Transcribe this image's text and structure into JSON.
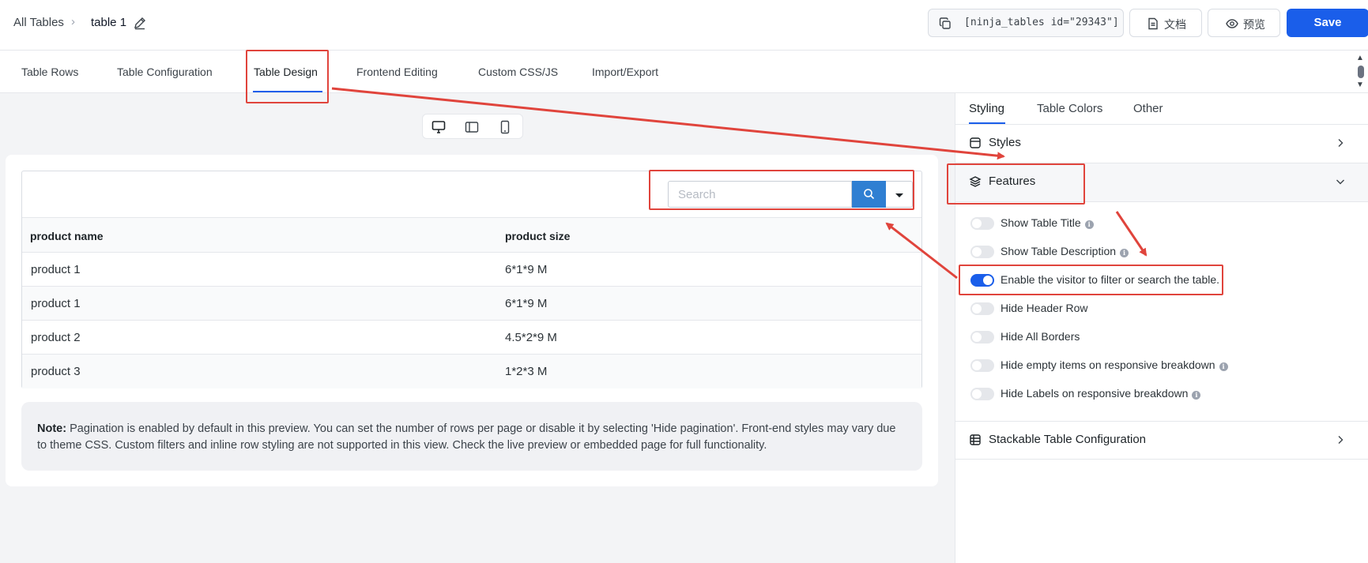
{
  "header": {
    "breadcrumb_all": "All Tables",
    "breadcrumb_sep": "›",
    "table_title": "table 1",
    "shortcode": "[ninja_tables id=\"29343\"]",
    "doc_label": "文档",
    "preview_label": "预览",
    "save_label": "Save"
  },
  "tabs": [
    {
      "label": "Table Rows"
    },
    {
      "label": "Table Configuration"
    },
    {
      "label": "Table Design",
      "active": true
    },
    {
      "label": "Frontend Editing"
    },
    {
      "label": "Custom CSS/JS"
    },
    {
      "label": "Import/Export"
    }
  ],
  "preview": {
    "devices": [
      "desktop-icon",
      "tablet-icon",
      "mobile-icon"
    ],
    "search_placeholder": "Search",
    "columns": [
      "product name",
      "product size"
    ],
    "rows": [
      [
        "product 1",
        "6*1*9 M"
      ],
      [
        "product 1",
        "6*1*9 M"
      ],
      [
        "product 2",
        "4.5*2*9 M"
      ],
      [
        "product 3",
        "1*2*3 M"
      ]
    ],
    "note_label": "Note:",
    "note_text": "Pagination is enabled by default in this preview. You can set the number of rows per page or disable it by selecting 'Hide pagination'. Front-end styles may vary due to theme CSS. Custom filters and inline row styling are not supported in this view. Check the live preview or embedded page for full functionality."
  },
  "panel": {
    "tabs": [
      {
        "label": "Styling",
        "active": true
      },
      {
        "label": "Table Colors"
      },
      {
        "label": "Other"
      }
    ],
    "sections": {
      "styles": "Styles",
      "features": "Features",
      "stackable": "Stackable Table Configuration"
    },
    "features": [
      {
        "label": "Show Table Title",
        "enabled": false,
        "info": true
      },
      {
        "label": "Show Table Description",
        "enabled": false,
        "info": true
      },
      {
        "label": "Enable the visitor to filter or search the table.",
        "enabled": true,
        "info": false
      },
      {
        "label": "Hide Header Row",
        "enabled": false,
        "info": false
      },
      {
        "label": "Hide All Borders",
        "enabled": false,
        "info": false
      },
      {
        "label": "Hide empty items on responsive breakdown",
        "enabled": false,
        "info": true
      },
      {
        "label": "Hide Labels on responsive breakdown",
        "enabled": false,
        "info": true
      }
    ]
  },
  "colors": {
    "accent": "#1a5eea",
    "search_button": "#2f7fd2",
    "annotation": "#e0443c"
  }
}
